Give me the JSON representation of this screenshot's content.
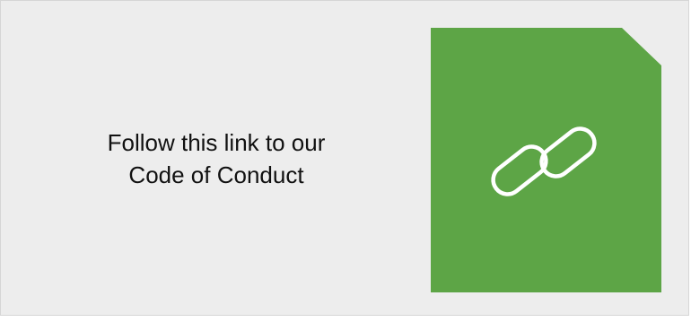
{
  "card": {
    "line1": "Follow this link to our",
    "line2": "Code of Conduct"
  },
  "link_tile": {
    "icon": "link-icon",
    "color": "#5da546"
  }
}
